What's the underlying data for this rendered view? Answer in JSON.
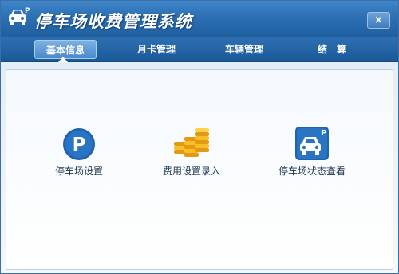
{
  "window": {
    "title": "停车场收费管理系统",
    "close_label": "×",
    "logo_icon": "car-parking-logo-icon",
    "logo_badge": "P"
  },
  "tabs": [
    {
      "label": "基本信息",
      "active": true
    },
    {
      "label": "月卡管理",
      "active": false
    },
    {
      "label": "车辆管理",
      "active": false
    },
    {
      "label": "结　算",
      "active": false
    }
  ],
  "features": [
    {
      "label": "停车场设置",
      "icon": "parking-p-icon",
      "icon_text": "P"
    },
    {
      "label": "费用设置录入",
      "icon": "coins-stack-icon"
    },
    {
      "label": "停车场状态查看",
      "icon": "car-parking-status-icon",
      "icon_text": "P"
    }
  ],
  "colors": {
    "title_bar": "#2c6fb3",
    "active_tab": "#5a97d2",
    "panel_bg": "#ffffff",
    "parking_icon": "#1f63b0",
    "coins": "#f2b51a"
  }
}
